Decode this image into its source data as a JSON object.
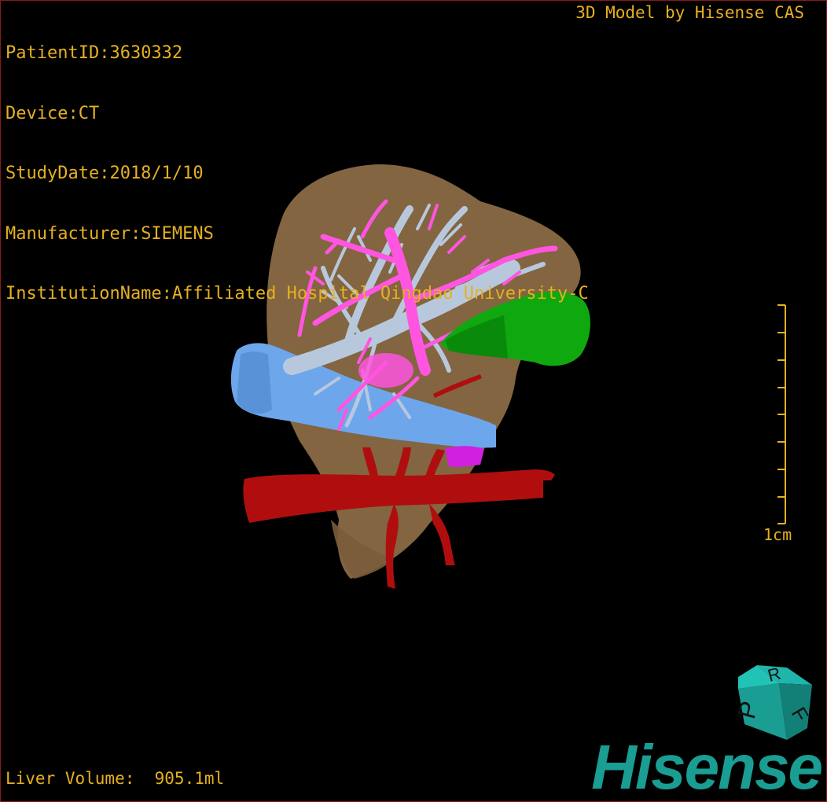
{
  "header": {
    "patient_id": "PatientID:3630332",
    "device": "Device:CT",
    "study_date": "StudyDate:2018/1/10",
    "manufacturer": "Manufacturer:SIEMENS",
    "institution": "InstitutionName:Affiliated Hospital Qingdao University-C"
  },
  "credit": "3D Model by Hisense CAS",
  "footer": {
    "volume_label": "Liver Volume:  905.1ml"
  },
  "scale_bar": {
    "label": "1cm"
  },
  "orientation_cube": {
    "faces": [
      "R",
      "F",
      "P"
    ]
  },
  "brand": {
    "logo_text": "Hisense"
  },
  "colors": {
    "text": "#e6b020",
    "liver": "#8a6a45",
    "portal_vein": "#ff55e0",
    "hepatic_vein": "#b8c8dc",
    "ivc": "#6ea6ec",
    "artery": "#b00e0e",
    "gallbladder": "#0fa80f",
    "brand": "#1a9d93"
  }
}
